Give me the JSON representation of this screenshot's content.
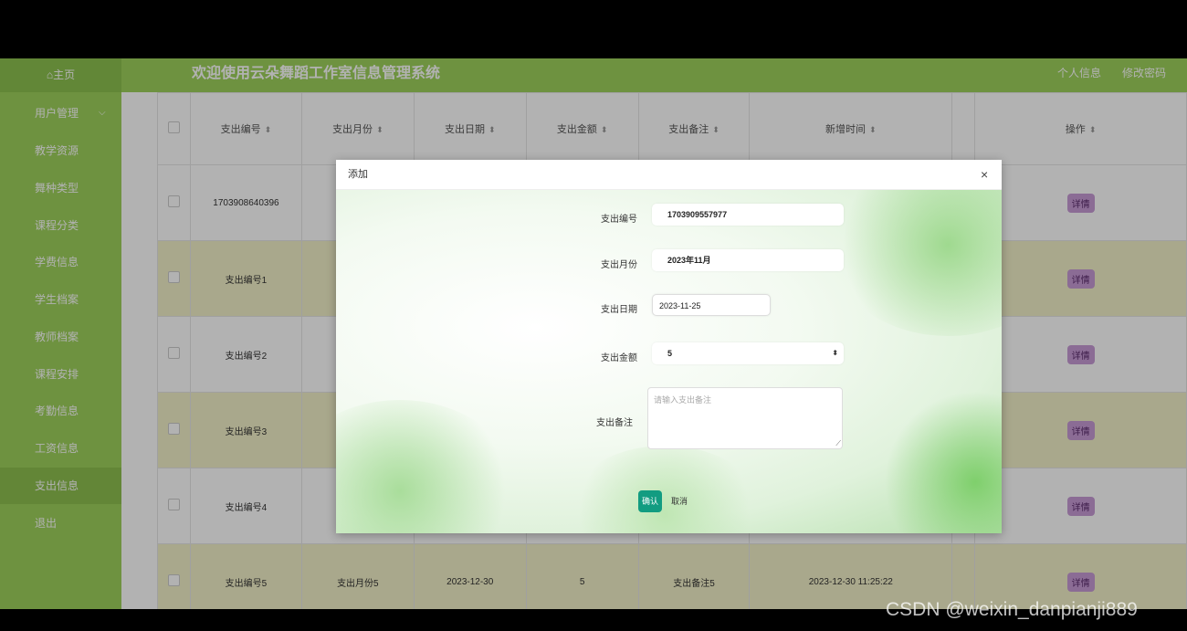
{
  "header": {
    "home_label": "⌂主页",
    "title": "欢迎使用云朵舞蹈工作室信息管理系统",
    "profile_label": "个人信息",
    "change_password_label": "修改密码"
  },
  "sidebar": {
    "items": [
      {
        "label": "用户管理"
      },
      {
        "label": "教学资源"
      },
      {
        "label": "舞种类型"
      },
      {
        "label": "课程分类"
      },
      {
        "label": "学费信息"
      },
      {
        "label": "学生档案"
      },
      {
        "label": "教师档案"
      },
      {
        "label": "课程安排"
      },
      {
        "label": "考勤信息"
      },
      {
        "label": "工资信息"
      },
      {
        "label": "支出信息"
      },
      {
        "label": "退出"
      }
    ],
    "active_index": 10
  },
  "table": {
    "headers": [
      "支出编号",
      "支出月份",
      "支出日期",
      "支出金额",
      "支出备注",
      "新增时间",
      "操作"
    ],
    "rows": [
      {
        "no": "1703908640396",
        "month": "",
        "date": "",
        "amount": "",
        "note": "",
        "time": "",
        "action": "详情"
      },
      {
        "no": "支出编号1",
        "month": "",
        "date": "",
        "amount": "",
        "note": "",
        "time": "",
        "action": "详情"
      },
      {
        "no": "支出编号2",
        "month": "",
        "date": "",
        "amount": "",
        "note": "",
        "time": "",
        "action": "详情"
      },
      {
        "no": "支出编号3",
        "month": "",
        "date": "",
        "amount": "",
        "note": "",
        "time": "",
        "action": "详情"
      },
      {
        "no": "支出编号4",
        "month": "",
        "date": "",
        "amount": "",
        "note": "",
        "time": "",
        "action": "详情"
      },
      {
        "no": "支出编号5",
        "month": "支出月份5",
        "date": "2023-12-30",
        "amount": "5",
        "note": "支出备注5",
        "time": "2023-12-30 11:25:22",
        "action": "详情"
      }
    ]
  },
  "dialog": {
    "title": "添加",
    "close": "×",
    "fields": {
      "no_label": "支出编号",
      "no_value": "1703909557977",
      "month_label": "支出月份",
      "month_value": "2023年11月",
      "date_label": "支出日期",
      "date_value": "2023-11-25",
      "amount_label": "支出金额",
      "amount_value": "5",
      "note_label": "支出备注",
      "note_placeholder": "请输入支出备注"
    },
    "confirm_label": "确认",
    "cancel_label": "取消"
  },
  "watermark": "CSDN @weixin_danpianji889"
}
